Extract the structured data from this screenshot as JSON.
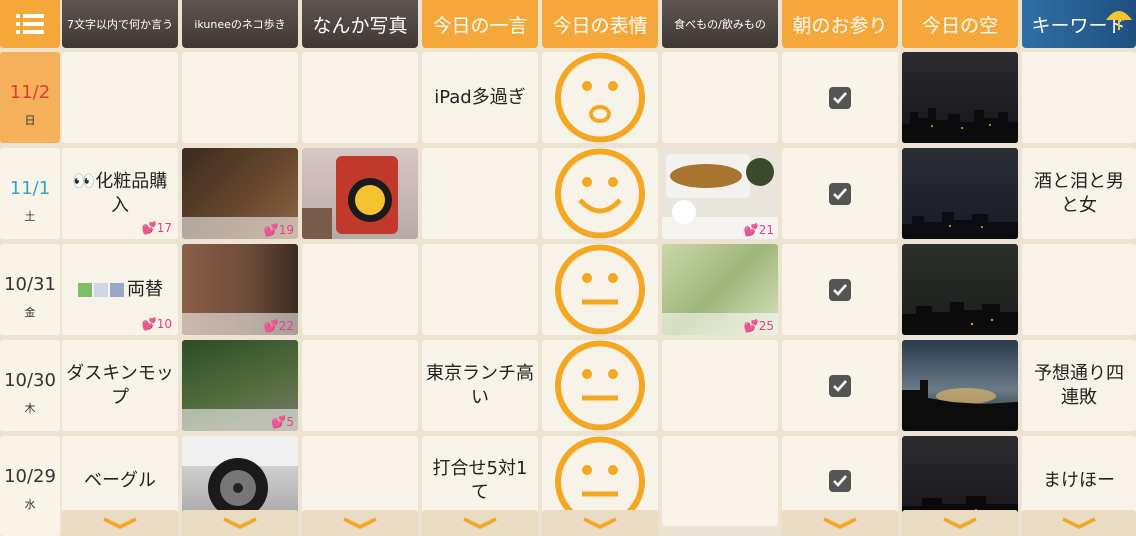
{
  "header": {
    "menu_icon": "list-icon",
    "columns": [
      {
        "label": "7文字以内で何か言う"
      },
      {
        "label": "ikuneeのネコ歩き"
      },
      {
        "label": "なんか写真"
      },
      {
        "label": "今日の一言"
      },
      {
        "label": "今日の表情"
      },
      {
        "label": "食べもの/飲みもの"
      },
      {
        "label": "朝のお参り"
      },
      {
        "label": "今日の空"
      },
      {
        "label": "キーワード"
      }
    ]
  },
  "rows": [
    {
      "date": "11/2",
      "weekday": "日",
      "date_color": "#e53935",
      "seven_char": "",
      "seven_likes": "",
      "neko_likes": "",
      "oneliner": "iPad多過ぎ",
      "face": "surprised",
      "food_likes": "",
      "omairi": true,
      "keyword": ""
    },
    {
      "date": "11/1",
      "weekday": "土",
      "date_color": "#2aa7c9",
      "seven_char": "👀化粧品購入",
      "seven_likes": "17",
      "neko_likes": "19",
      "oneliner": "",
      "face": "smile",
      "food_likes": "21",
      "omairi": true,
      "keyword": "酒と泪と男と女"
    },
    {
      "date": "10/31",
      "weekday": "金",
      "date_color": "#333333",
      "seven_char": "両替",
      "seven_likes": "10",
      "neko_likes": "22",
      "oneliner": "",
      "face": "neutral",
      "food_likes": "25",
      "omairi": true,
      "keyword": ""
    },
    {
      "date": "10/30",
      "weekday": "木",
      "date_color": "#333333",
      "seven_char": "ダスキンモップ",
      "seven_likes": "",
      "neko_likes": "5",
      "oneliner": "東京ランチ高い",
      "face": "neutral",
      "food_likes": "",
      "omairi": true,
      "keyword": "予想通り四連敗"
    },
    {
      "date": "10/29",
      "weekday": "水",
      "date_color": "#333333",
      "seven_char": "ベーグル",
      "seven_likes": "",
      "neko_likes": "",
      "oneliner": "打合せ5対1て",
      "face": "neutral",
      "food_likes": "",
      "omairi": true,
      "keyword": "まけほー"
    }
  ],
  "colors": {
    "accent": "#f5a73a",
    "face": "#f5a623",
    "likes": "#e83e8c"
  },
  "icons": {
    "check": "checkbox-checked-icon",
    "more": "chevron-down-icon",
    "heart": "heart-icon",
    "money": "banknote-icon",
    "umbrella": "umbrella-icon"
  }
}
